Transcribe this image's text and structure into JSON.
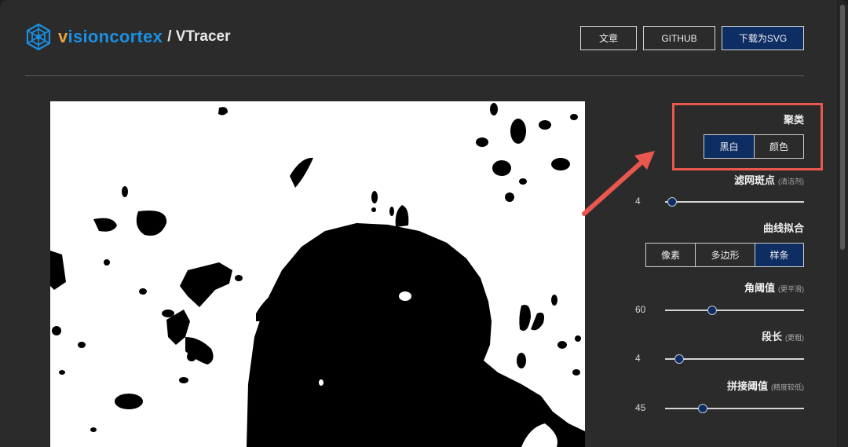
{
  "header": {
    "brand_v": "v",
    "brand_rest": "isioncortex",
    "separator_product": "/ VTracer",
    "nav": {
      "articles": "文章",
      "github": "GITHUB",
      "download": "下载为SVG"
    }
  },
  "controls": {
    "clustering": {
      "title": "聚类",
      "options": [
        "黑白",
        "颜色"
      ],
      "selected": "黑白"
    },
    "filter_speckle": {
      "title": "滤网斑点",
      "note": "(清洁剂)",
      "value": "4",
      "level": 0.05
    },
    "curve_fitting": {
      "title": "曲线拟合",
      "options": [
        "像素",
        "多边形",
        "样条"
      ],
      "selected": "样条"
    },
    "corner_threshold": {
      "title": "角阈值",
      "note": "(更平滑)",
      "value": "60",
      "level": 0.34
    },
    "segment_length": {
      "title": "段长",
      "note": "(更粗)",
      "value": "4",
      "level": 0.1
    },
    "splice_threshold": {
      "title": "拼接阈值",
      "note": "(精度较低)",
      "value": "45",
      "level": 0.27
    }
  },
  "colors": {
    "accent": "#0e2d63",
    "brand_orange": "#e8a33d",
    "brand_blue": "#1a8fe3",
    "annotation_red": "#e9574e",
    "background": "#2b2b2b"
  },
  "icons": {
    "logo": "vision-cortex-hex-logo-icon"
  }
}
